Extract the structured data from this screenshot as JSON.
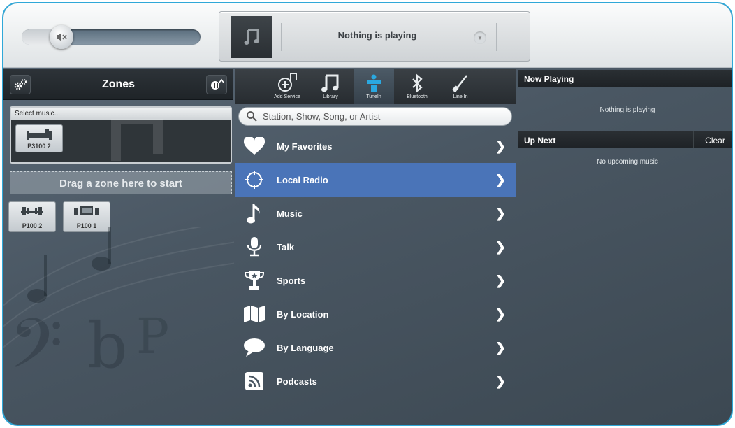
{
  "volume": {
    "muted": true,
    "level": 0.18
  },
  "now_playing_bar": {
    "text": "Nothing is playing"
  },
  "zones": {
    "title": "Zones",
    "group": {
      "select_label": "Select music...",
      "zone": "P3100 2"
    },
    "drop_hint": "Drag a zone here to start",
    "available": [
      "P100 2",
      "P100 1"
    ]
  },
  "tabs": [
    {
      "label": "Add Service",
      "icon": "add-service-icon"
    },
    {
      "label": "Library",
      "icon": "music-note-icon"
    },
    {
      "label": "TuneIn",
      "icon": "tunein-icon"
    },
    {
      "label": "Bluetooth",
      "icon": "bluetooth-icon"
    },
    {
      "label": "Line In",
      "icon": "line-in-icon"
    }
  ],
  "search": {
    "placeholder": "Station, Show, Song, or Artist"
  },
  "menu": [
    {
      "label": "My Favorites",
      "icon": "heart-icon"
    },
    {
      "label": "Local Radio",
      "icon": "crosshair-icon"
    },
    {
      "label": "Music",
      "icon": "music-note-icon"
    },
    {
      "label": "Talk",
      "icon": "microphone-icon"
    },
    {
      "label": "Sports",
      "icon": "trophy-icon"
    },
    {
      "label": "By Location",
      "icon": "map-icon"
    },
    {
      "label": "By Language",
      "icon": "speech-bubble-icon"
    },
    {
      "label": "Podcasts",
      "icon": "rss-icon"
    }
  ],
  "queue": {
    "now_playing_title": "Now Playing",
    "now_playing_text": "Nothing is playing",
    "up_next_title": "Up Next",
    "clear_label": "Clear",
    "up_next_text": "No upcoming music"
  },
  "colors": {
    "accent_border": "#2fa8d8",
    "active_row": "#4a74b8"
  }
}
